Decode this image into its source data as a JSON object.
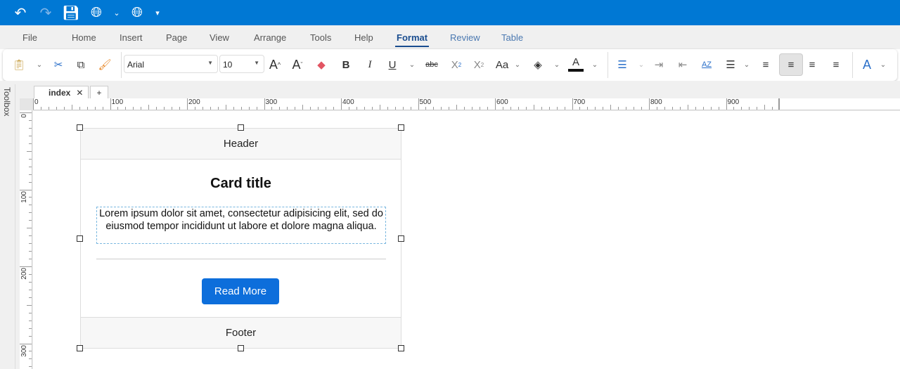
{
  "quick_access": {
    "undo": "undo-icon",
    "redo": "redo-icon",
    "save": "save-icon",
    "preview": "web-preview-icon",
    "publish": "publish-globe-icon",
    "customize": "customize-icon"
  },
  "menu": [
    {
      "label": "File"
    },
    {
      "label": "Home"
    },
    {
      "label": "Insert"
    },
    {
      "label": "Page"
    },
    {
      "label": "View"
    },
    {
      "label": "Arrange"
    },
    {
      "label": "Tools"
    },
    {
      "label": "Help"
    },
    {
      "label": "Format",
      "active": true
    },
    {
      "label": "Review"
    },
    {
      "label": "Table"
    }
  ],
  "ribbon": {
    "font_family": "Arial",
    "font_size": "10",
    "bold": "B",
    "italic": "I",
    "underline": "U",
    "strikethrough": "abc",
    "case": "Aa",
    "align_active": "center"
  },
  "toolbox_label": "Toolbox",
  "tabs": [
    {
      "label": "index"
    }
  ],
  "add_tab": "+",
  "ruler": {
    "h": [
      "0",
      "100",
      "200",
      "300",
      "400",
      "500",
      "600",
      "700",
      "800",
      "900"
    ],
    "v": [
      "0",
      "100",
      "200",
      "300"
    ]
  },
  "card": {
    "header": "Header",
    "title": "Card title",
    "text": "Lorem ipsum dolor sit amet, consectetur adipisicing elit, sed do eiusmod tempor incididunt ut labore et dolore magna aliqua.",
    "button": "Read More",
    "footer": "Footer"
  },
  "colors": {
    "accent": "#0078d4",
    "button": "#0d6edb",
    "active_menu": "#1a4d8f"
  }
}
